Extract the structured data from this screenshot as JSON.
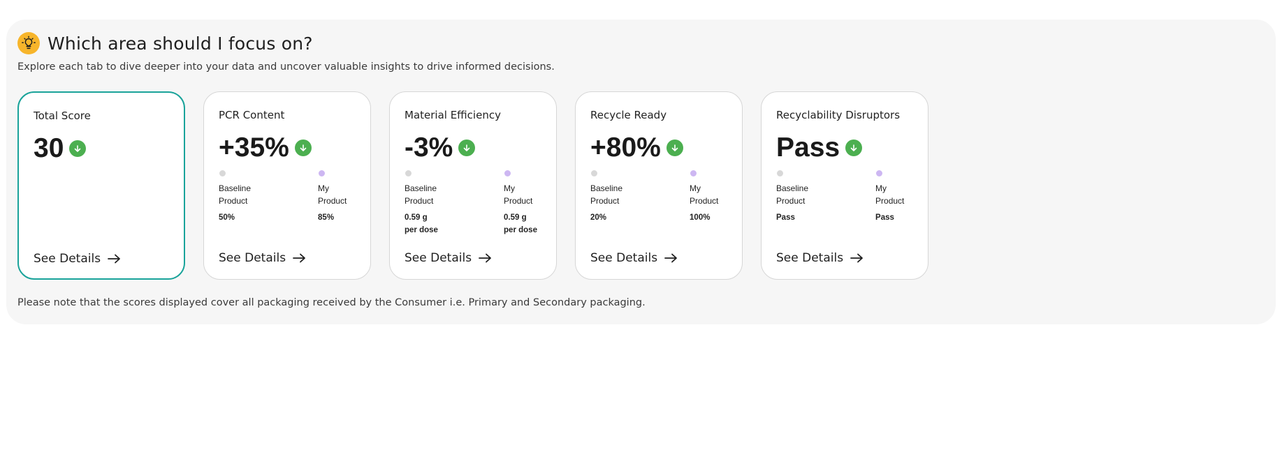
{
  "header": {
    "icon": "lightbulb-icon",
    "title": "Which area should I focus on?",
    "subtitle": "Explore each tab to dive deeper into your data and uncover valuable insights to drive informed decisions."
  },
  "colors": {
    "accent_border": "#1aa39a",
    "badge_green": "#4caf50",
    "baseline_dot": "#d8d8d8",
    "my_product_dot": "#cdb7f2",
    "bulb": "#f7b52b"
  },
  "cards": [
    {
      "title": "Total Score",
      "value": "30",
      "badge_icon": "arrow-down-icon",
      "see_details": "See Details"
    },
    {
      "title": "PCR Content",
      "value": "+35%",
      "badge_icon": "arrow-down-icon",
      "baseline_label": "Baseline\nProduct",
      "my_label": "My\nProduct",
      "baseline_value": "50%",
      "my_value": "85%",
      "see_details": "See Details"
    },
    {
      "title": "Material Efficiency",
      "value": "-3%",
      "badge_icon": "arrow-down-icon",
      "baseline_label": "Baseline\nProduct",
      "my_label": "My\nProduct",
      "baseline_value": "0.59 g\nper dose",
      "my_value": "0.59 g\nper dose",
      "see_details": "See Details"
    },
    {
      "title": "Recycle Ready",
      "value": "+80%",
      "badge_icon": "arrow-down-icon",
      "baseline_label": "Baseline\nProduct",
      "my_label": "My\nProduct",
      "baseline_value": "20%",
      "my_value": "100%",
      "see_details": "See Details"
    },
    {
      "title": "Recyclability Disruptors",
      "value": "Pass",
      "badge_icon": "arrow-down-icon",
      "baseline_label": "Baseline\nProduct",
      "my_label": "My\nProduct",
      "baseline_value": "Pass",
      "my_value": "Pass",
      "see_details": "See Details"
    }
  ],
  "note": "Please note that the scores displayed cover all packaging received by the Consumer i.e. Primary and Secondary packaging."
}
